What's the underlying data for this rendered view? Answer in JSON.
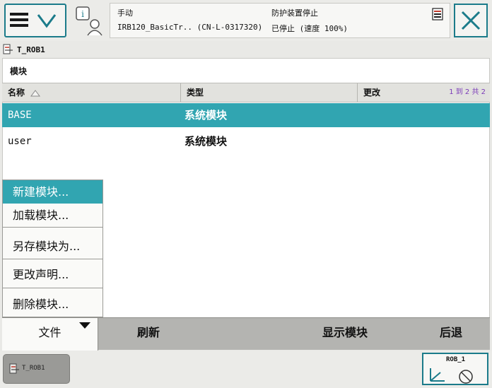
{
  "status": {
    "mode": "手动",
    "station": "IRB120_BasicTr.. (CN-L-0317320)",
    "guard_state": "防护装置停止",
    "motion_state": "已停止 (速度 100%)"
  },
  "task_tab": {
    "label": "T_ROB1"
  },
  "section": {
    "title": "模块"
  },
  "table": {
    "headers": {
      "name": "名称",
      "type": "类型",
      "changed": "更改"
    },
    "range": "1 到 2 共 2",
    "rows": [
      {
        "name": "BASE",
        "type": "系统模块",
        "changed": ""
      },
      {
        "name": "user",
        "type": "系统模块",
        "changed": ""
      }
    ]
  },
  "popup_menu": {
    "items": [
      "新建模块...",
      "加载模块...",
      "另存模块为...",
      "更改声明...",
      "删除模块..."
    ]
  },
  "command_bar": {
    "file": "文件",
    "refresh": "刷新",
    "show_module": "显示模块",
    "back": "后退"
  },
  "taskbar": {
    "task_button": "T_ROB1",
    "quickset_label": "ROB_1"
  },
  "colors": {
    "accent": "#1b7b8a",
    "selection": "#31a5b1",
    "range_text": "#7a3ab8"
  },
  "icons": [
    "menu-icon",
    "chevron-down-icon",
    "robot-status-icon",
    "close-icon",
    "program-icon",
    "sort-asc-icon",
    "quickset-icon"
  ]
}
